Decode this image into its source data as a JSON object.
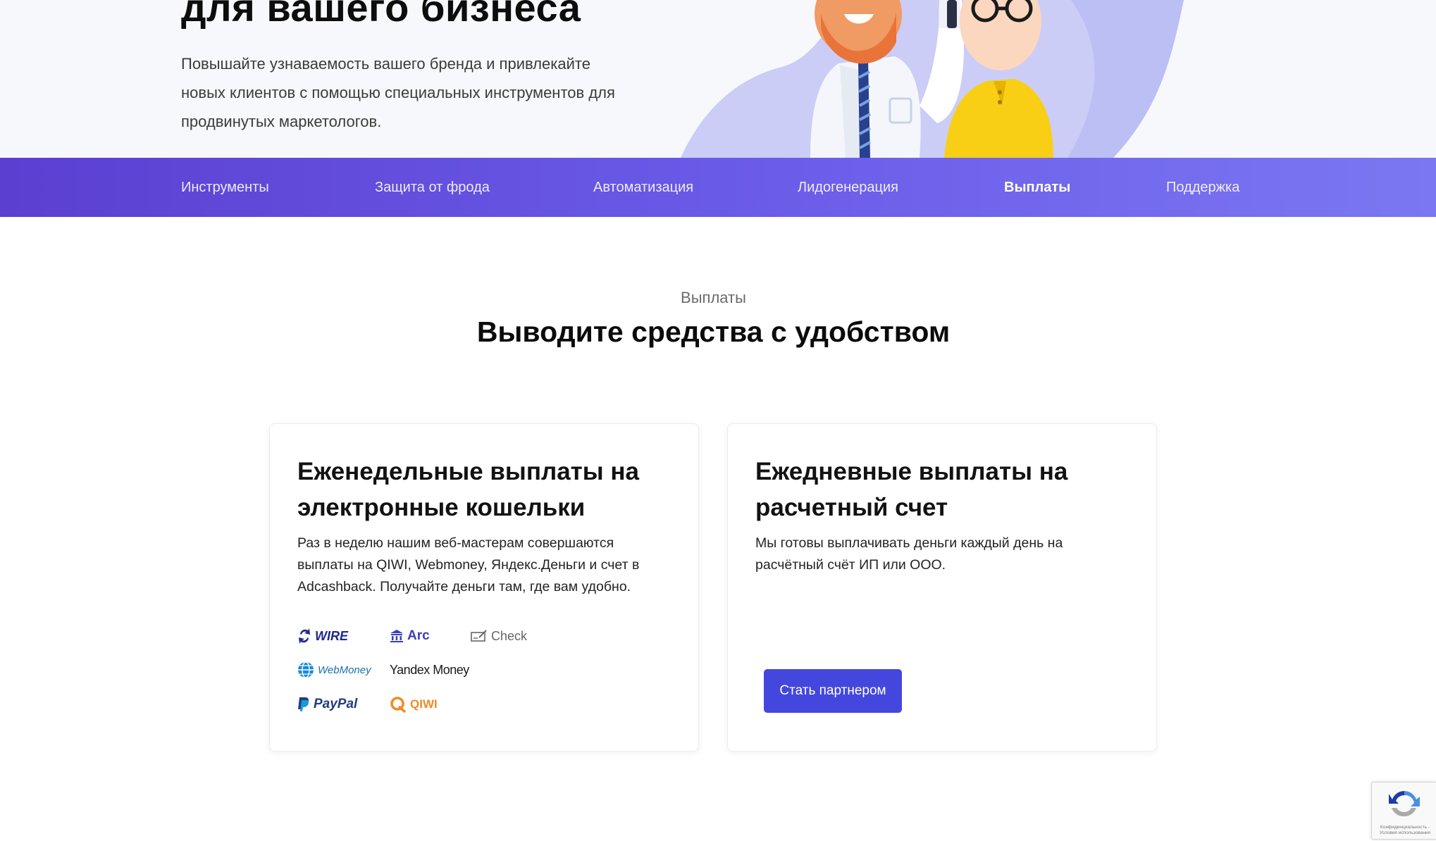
{
  "hero": {
    "title": "для вашего бизнеса",
    "description": "Повышайте узнаваемость вашего бренда и привлекайте новых клиентов с помощью специальных инструментов для продвинутых маркетологов."
  },
  "nav": {
    "items": [
      {
        "label": "Инструменты"
      },
      {
        "label": "Защита от фрода"
      },
      {
        "label": "Автоматизация"
      },
      {
        "label": "Лидогенерация"
      },
      {
        "label": "Выплаты"
      },
      {
        "label": "Поддержка"
      }
    ],
    "active": "Выплаты"
  },
  "section": {
    "eyebrow": "Выплаты",
    "title": "Выводите средства с удобством"
  },
  "cards": [
    {
      "title": "Еженедельные выплаты на электронные кошельки",
      "text": "Раз в неделю нашим веб-мастерам совершаются выплаты на QIWI, Webmoney, Яндекс.Деньги и счет в Adcashback. Получайте деньги там, где вам удобно.",
      "payment_methods": [
        {
          "label": "WIRE",
          "icon": "wire-transfer-icon",
          "color": "#1f2a8a"
        },
        {
          "label": "Arc",
          "icon": "bank-building-icon",
          "color": "#3b3fb8"
        },
        {
          "label": "Check",
          "icon": "check-pen-icon",
          "color": "#666666"
        },
        {
          "label": "WebMoney",
          "icon": "webmoney-globe-icon",
          "color": "#1a8ad4"
        },
        {
          "label": "Yandex Money",
          "icon": "",
          "color": "#e2231a"
        },
        {
          "label": "PayPal",
          "icon": "paypal-icon",
          "color": "#253b80"
        },
        {
          "label": "QIWI",
          "icon": "qiwi-icon",
          "color": "#f08a24"
        }
      ]
    },
    {
      "title": "Ежедневные выплаты на расчетный счет",
      "text": "Мы готовы выплачивать деньги каждый день на расчётный счёт ИП или ООО.",
      "button_label": "Стать партнером"
    }
  ],
  "recaptcha": {
    "footer": "Конфиденциальность - Условия использования"
  },
  "colors": {
    "nav_gradient_start": "#5b3fd0",
    "nav_gradient_end": "#7b77f2",
    "button": "#4447dd",
    "hero_bg": "#f7f8fb"
  }
}
